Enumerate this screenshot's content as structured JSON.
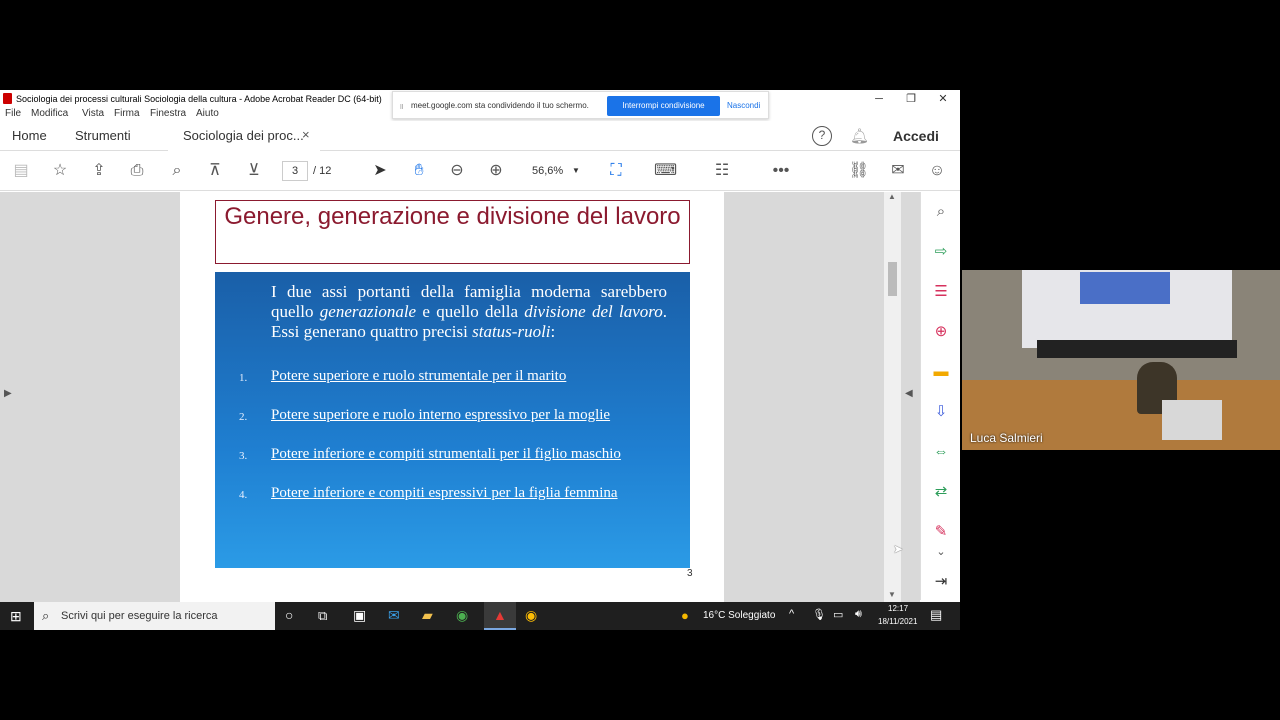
{
  "window": {
    "title": "Sociologia dei processi culturali Sociologia della cultura - Adobe Acrobat Reader DC (64-bit)",
    "controls": [
      "─",
      "❐",
      "✕"
    ]
  },
  "share_bar": {
    "message": "meet.google.com sta condividendo il tuo schermo.",
    "stop_label": "Interrompi condivisione",
    "hide_label": "Nascondi"
  },
  "menu": [
    "File",
    "Modifica",
    "Vista",
    "Firma",
    "Finestra",
    "Aiuto"
  ],
  "tabs": {
    "home": "Home",
    "tools": "Strumenti",
    "document": "Sociologia dei proc...",
    "close": "×",
    "signin": "Accedi"
  },
  "toolbar": {
    "page_current": "3",
    "page_total": "/ 12",
    "zoom": "56,6%"
  },
  "slide": {
    "title": "Genere, generazione e divisione del lavoro",
    "intro_parts": [
      "I due assi portanti della famiglia moderna sarebbero quello ",
      "generazionale",
      " e quello della ",
      "divisione del lavoro",
      ". Essi generano quattro precisi ",
      "status-ruoli",
      ":"
    ],
    "items": [
      {
        "num": "1.",
        "text": "Potere superiore e ruolo strumentale per il marito"
      },
      {
        "num": "2.",
        "text": "Potere superiore e ruolo interno espressivo per la moglie"
      },
      {
        "num": "3.",
        "text": "Potere inferiore e compiti strumentali per il figlio maschio"
      },
      {
        "num": "4.",
        "text": "Potere inferiore e compiti espressivi per la figlia femmina"
      }
    ],
    "page_number": "3"
  },
  "taskbar": {
    "search_placeholder": "Scrivi qui per eseguire la ricerca",
    "weather": "16°C  Soleggiato",
    "time": "12:17",
    "date": "18/11/2021"
  },
  "video": {
    "participant": "Luca Salmieri"
  }
}
